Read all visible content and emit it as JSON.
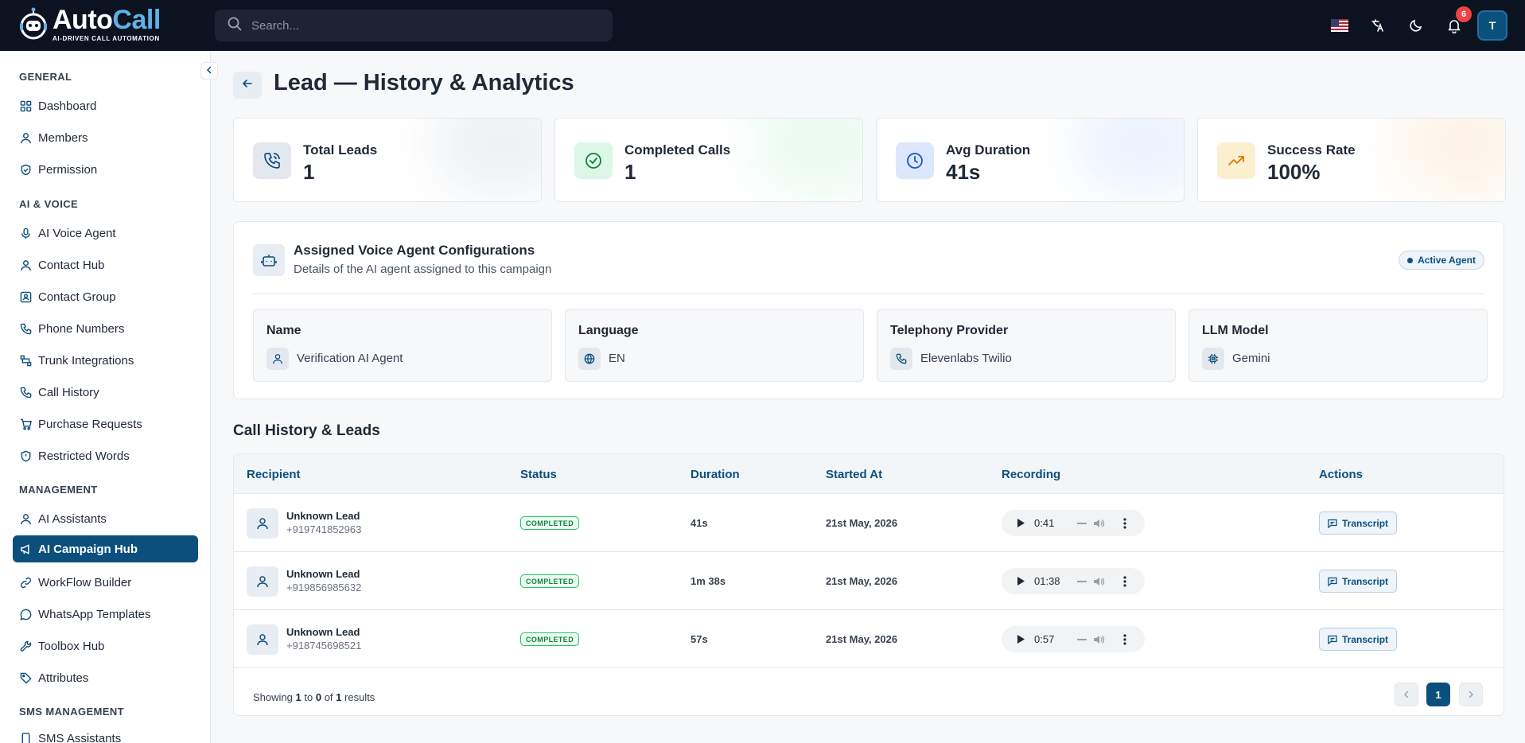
{
  "brand": {
    "name_part1": "Auto",
    "name_part2": "Call",
    "tagline": "AI-DRIVEN CALL AUTOMATION"
  },
  "search": {
    "placeholder": "Search..."
  },
  "topbar": {
    "notifications_count": "6",
    "avatar_initial": "T"
  },
  "sidebar": {
    "sections": [
      {
        "title": "GENERAL",
        "items": [
          "Dashboard",
          "Members",
          "Permission"
        ]
      },
      {
        "title": "AI & VOICE",
        "items": [
          "AI Voice Agent",
          "Contact Hub",
          "Contact Group",
          "Phone Numbers",
          "Trunk Integrations",
          "Call History",
          "Purchase Requests",
          "Restricted Words"
        ]
      },
      {
        "title": "MANAGEMENT",
        "items": [
          "AI Assistants",
          "AI Campaign Hub",
          "WorkFlow Builder",
          "WhatsApp Templates",
          "Toolbox Hub",
          "Attributes"
        ]
      },
      {
        "title": "SMS MANAGEMENT",
        "items": [
          "SMS Assistants"
        ]
      }
    ],
    "active_item": "AI Campaign Hub"
  },
  "page": {
    "title": "Lead — History & Analytics"
  },
  "stats": [
    {
      "label": "Total Leads",
      "value": "1"
    },
    {
      "label": "Completed Calls",
      "value": "1"
    },
    {
      "label": "Avg Duration",
      "value": "41s"
    },
    {
      "label": "Success Rate",
      "value": "100%"
    }
  ],
  "agent": {
    "title": "Assigned Voice Agent Configurations",
    "subtitle": "Details of the AI agent assigned to this campaign",
    "badge": "Active Agent",
    "configs": [
      {
        "label": "Name",
        "value": "Verification AI Agent"
      },
      {
        "label": "Language",
        "value": "EN"
      },
      {
        "label": "Telephony Provider",
        "value": "Elevenlabs Twilio"
      },
      {
        "label": "LLM Model",
        "value": "Gemini"
      }
    ]
  },
  "calls": {
    "heading": "Call History & Leads",
    "columns": [
      "Recipient",
      "Status",
      "Duration",
      "Started At",
      "Recording",
      "Actions"
    ],
    "rows": [
      {
        "name": "Unknown Lead",
        "phone": "+919741852963",
        "status": "COMPLETED",
        "duration": "41s",
        "started": "21st May, 2026",
        "recording_time": "0:41",
        "action": "Transcript"
      },
      {
        "name": "Unknown Lead",
        "phone": "+919856985632",
        "status": "COMPLETED",
        "duration": "1m 38s",
        "started": "21st May, 2026",
        "recording_time": "01:38",
        "action": "Transcript"
      },
      {
        "name": "Unknown Lead",
        "phone": "+918745698521",
        "status": "COMPLETED",
        "duration": "57s",
        "started": "21st May, 2026",
        "recording_time": "0:57",
        "action": "Transcript"
      }
    ],
    "footer": {
      "showing": "Showing",
      "from": "1",
      "to_word": "to",
      "to": "0",
      "of_word": "of",
      "total": "1",
      "results": "results",
      "current_page": "1"
    }
  },
  "colors": {
    "brand": "#0b4f7d",
    "topbar": "#0b1220",
    "success": "#22c55e",
    "badge": "#ef4444"
  }
}
